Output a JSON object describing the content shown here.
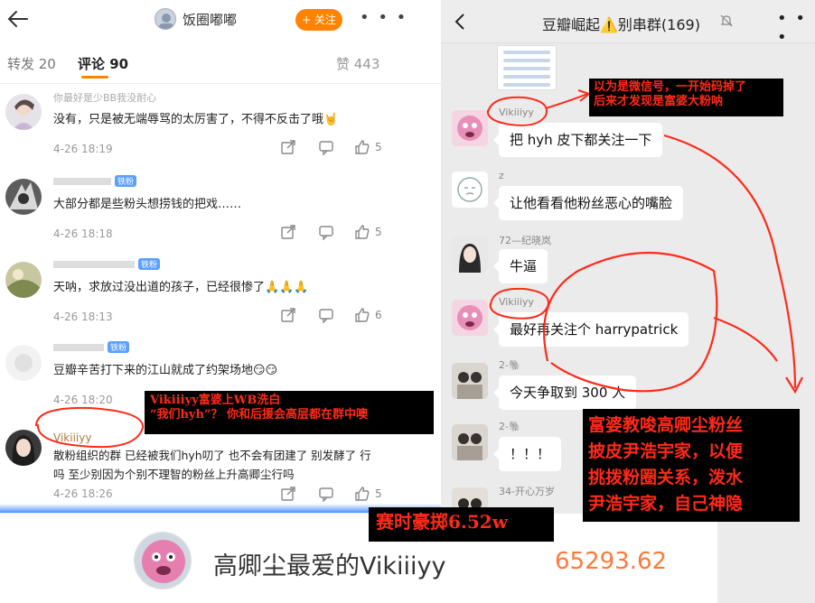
{
  "weibo": {
    "top_user": "饭圈嘟嘟",
    "follow_label": "+ 关注",
    "more_label": "• • •",
    "tabs": {
      "repost": "转发 20",
      "comment": "评论 90",
      "like": "赞 443"
    },
    "comments": [
      {
        "name": "你最好是少BB我没耐心",
        "badge": "",
        "text": "没有，只是被无端辱骂的太厉害了，不得不反击了哦🤘",
        "time": "4-26 18:19",
        "likes": "5"
      },
      {
        "name": "",
        "badge": "铁粉",
        "text": "大部分都是些粉头想捞钱的把戏……",
        "time": "4-26 18:18",
        "likes": "5"
      },
      {
        "name": "",
        "badge": "铁粉",
        "text": "天呐，求放过没出道的孩子，已经很惨了🙏🙏🙏",
        "time": "4-26 18:13",
        "likes": "6"
      },
      {
        "name": "",
        "badge": "铁粉",
        "text": "豆瓣辛苦打下来的江山就成了约架场地😏😏",
        "time": "4-26 18:20",
        "likes": ""
      },
      {
        "name": "Vikiiiyy",
        "badge": "",
        "text": "散粉组织的群 已经被我们hyh叨了 也不会有团建了 别发酵了 行吗 至少别因为个别不理智的粉丝上升高卿尘行吗",
        "time": "4-26 18:26",
        "likes": "5"
      }
    ]
  },
  "chat": {
    "title": "豆瓣崛起⚠️别串群(169)",
    "more_label": "• • •",
    "messages": [
      {
        "name": "Vikiiiyy",
        "text": "把 hyh 皮下都关注一下"
      },
      {
        "name": "z",
        "text": "让他看看他粉丝恶心的嘴脸"
      },
      {
        "name": "72—纪晓岚",
        "text": "牛逼"
      },
      {
        "name": "Vikiiiyy",
        "text": "最好再关注个 harrypatrick"
      },
      {
        "name": "2-🐘",
        "text": "今天争取到 300 人"
      },
      {
        "name": "2-🐘",
        "text": "！！！"
      },
      {
        "name": "34-开心万岁",
        "text": ""
      }
    ]
  },
  "annotations": {
    "note1_line1": "Vikiiiyy富婆上WB洗白",
    "note1_line2": "“我们hyh”？ 你和后援会高层都在群中噢",
    "note2_line1": "以为是微信号，一开始码掉了",
    "note2_line2": "后来才发现是富婆大粉呐",
    "note3_lines": [
      "富婆教唆高卿尘粉丝",
      "披皮尹浩宇家，以便",
      "挑拨粉圈关系，泼水",
      "尹浩宇家，自己神隐"
    ],
    "note4": "赛时豪掷6.52w"
  },
  "bottom": {
    "name": "高卿尘最爱的Vikiiiyy",
    "amount": "65293.62"
  },
  "colors": {
    "accent": "#ff8200",
    "annotation_red": "#ff2a1a",
    "badge_blue": "#5aa0ff",
    "amount_orange": "#ff7a3a"
  }
}
